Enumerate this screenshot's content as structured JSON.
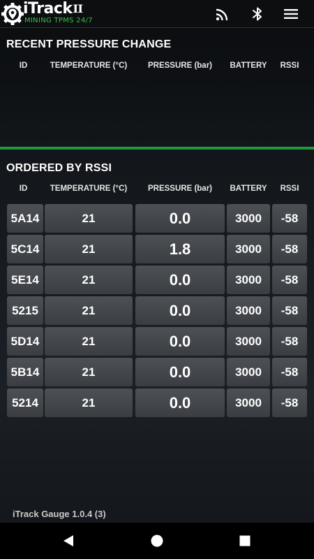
{
  "app": {
    "logo_text": "iTrack",
    "logo_roman": "II",
    "logo_subtitle": "MINING TPMS 24/7",
    "logo_icon": "gear-map-pin-icon"
  },
  "toolbar": {
    "cast_icon": "cast-icon",
    "bluetooth_icon": "bluetooth-icon",
    "menu_icon": "hamburger-menu-icon"
  },
  "recent": {
    "title": "RECENT PRESSURE CHANGE",
    "columns": {
      "id": "ID",
      "temperature": "TEMPERATURE (°C)",
      "pressure": "PRESSURE (bar)",
      "battery": "BATTERY",
      "rssi": "RSSI"
    },
    "rows": []
  },
  "ordered": {
    "title": "ORDERED BY RSSI",
    "columns": {
      "id": "ID",
      "temperature": "TEMPERATURE (°C)",
      "pressure": "PRESSURE (bar)",
      "battery": "BATTERY",
      "rssi": "RSSI"
    },
    "rows": [
      {
        "id": "5A14",
        "temperature": "21",
        "pressure": "0.0",
        "battery": "3000",
        "rssi": "-58"
      },
      {
        "id": "5C14",
        "temperature": "21",
        "pressure": "1.8",
        "battery": "3000",
        "rssi": "-58"
      },
      {
        "id": "5E14",
        "temperature": "21",
        "pressure": "0.0",
        "battery": "3000",
        "rssi": "-58"
      },
      {
        "id": "5215",
        "temperature": "21",
        "pressure": "0.0",
        "battery": "3000",
        "rssi": "-58"
      },
      {
        "id": "5D14",
        "temperature": "21",
        "pressure": "0.0",
        "battery": "3000",
        "rssi": "-58"
      },
      {
        "id": "5B14",
        "temperature": "21",
        "pressure": "0.0",
        "battery": "3000",
        "rssi": "-58"
      },
      {
        "id": "5214",
        "temperature": "21",
        "pressure": "0.0",
        "battery": "3000",
        "rssi": "-58"
      }
    ]
  },
  "footer": {
    "version": "iTrack Gauge 1.0.4 (3)"
  },
  "navbar": {
    "back_icon": "back-triangle-icon",
    "home_icon": "home-circle-icon",
    "recent_icon": "recent-apps-square-icon"
  },
  "colors": {
    "accent_green": "#1f9a3c",
    "logo_green": "#38c24c",
    "cell_bg": "#44484d"
  }
}
